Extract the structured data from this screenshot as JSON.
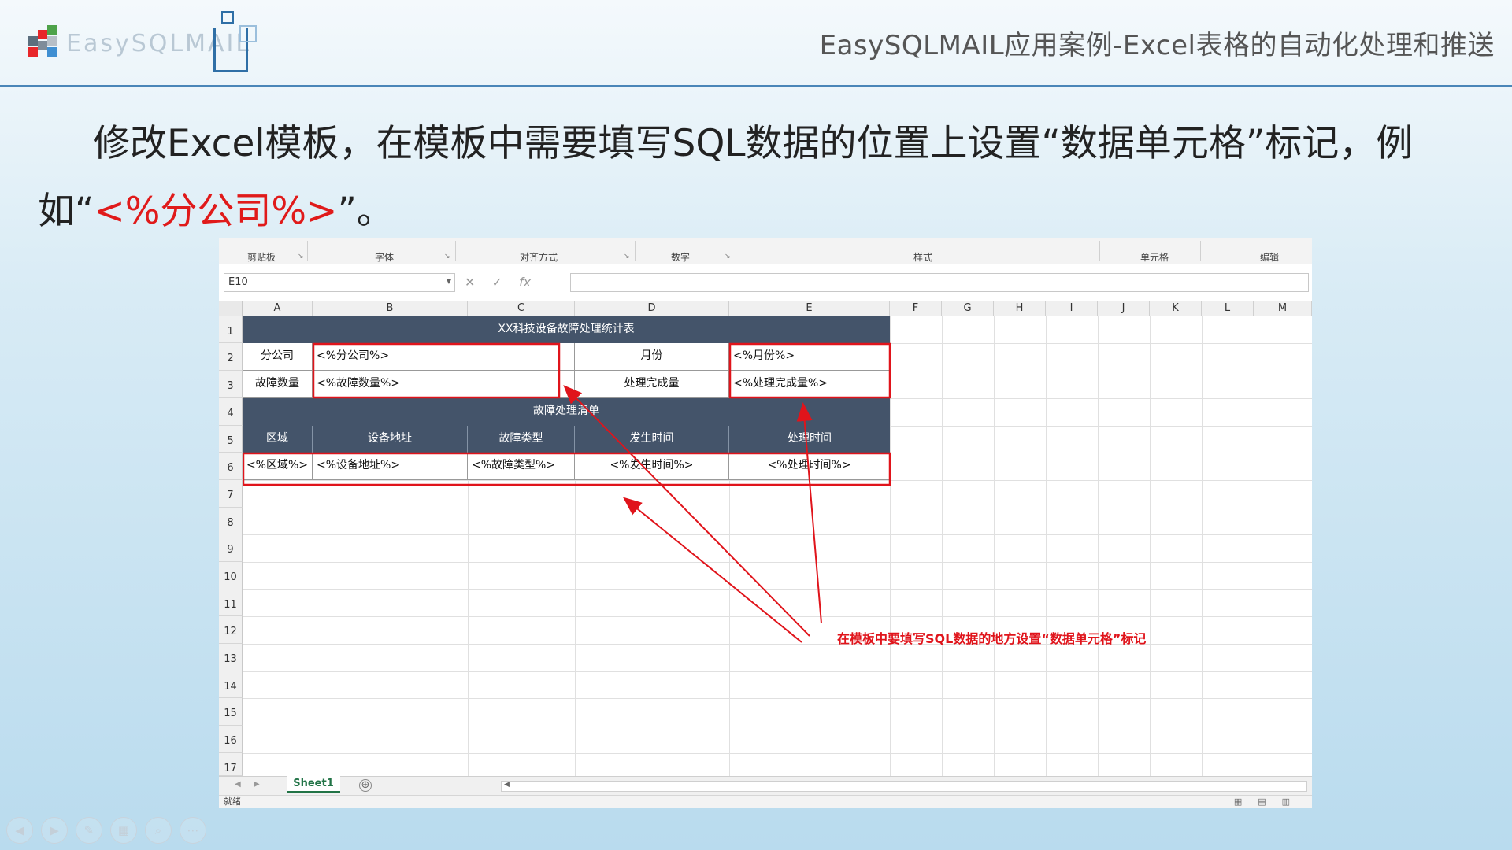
{
  "header": {
    "logo_text": "EasySQLMAIL",
    "slide_title": "EasySQLMAIL应用案例-Excel表格的自动化处理和推送"
  },
  "paragraph": {
    "line1": "修改Excel模板，在模板中需要填写SQL数据的位置上设置“数据单元格”标记，例",
    "line2_prefix": "如“",
    "line2_red": "<%分公司%>",
    "line2_suffix": "”。"
  },
  "excel": {
    "ribbon_groups": [
      "剪贴板",
      "字体",
      "对齐方式",
      "数字",
      "样式",
      "单元格",
      "编辑"
    ],
    "name_box": "E10",
    "formula_icons": [
      "✕",
      "✓",
      "fx"
    ],
    "columns": [
      "A",
      "B",
      "C",
      "D",
      "E",
      "F",
      "G",
      "H",
      "I",
      "J",
      "K",
      "L",
      "M"
    ],
    "rows": [
      "1",
      "2",
      "3",
      "4",
      "5",
      "6",
      "7",
      "8",
      "9",
      "10",
      "11",
      "12",
      "13",
      "14",
      "15",
      "16",
      "17"
    ],
    "table": {
      "title": "XX科技设备故障处理统计表",
      "r2": {
        "a": "分公司",
        "b": "<%分公司%>",
        "d": "月份",
        "e": "<%月份%>"
      },
      "r3": {
        "a": "故障数量",
        "b": "<%故障数量%>",
        "d": "处理完成量",
        "e": "<%处理完成量%>"
      },
      "section": "故障处理清单",
      "headers": [
        "区域",
        "设备地址",
        "故障类型",
        "发生时间",
        "处理时间"
      ],
      "row6": [
        "<%区域%>",
        "<%设备地址%>",
        "<%故障类型%>",
        "<%发生时间%>",
        "<%处理时间%>"
      ]
    },
    "annotation": "在模板中要填写SQL数据的地方设置“数据单元格”标记",
    "sheet_tab": "Sheet1",
    "add_sheet": "⊕",
    "status": "就绪"
  },
  "slide_nav": [
    "◀",
    "▶",
    "✎",
    "▦",
    "⌕",
    "⋯"
  ],
  "colors": {
    "accent_red": "#e01a1a",
    "header_dark": "#44546a",
    "excel_green": "#217346"
  }
}
